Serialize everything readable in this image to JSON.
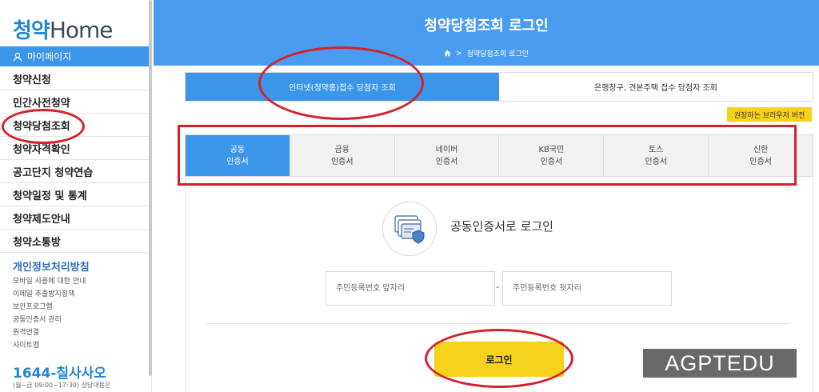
{
  "sidebar": {
    "logo_ko": "청약",
    "logo_en": "Home",
    "mypage_label": "마이페이지",
    "menu": [
      "청약신청",
      "민간사전청약",
      "청약당첨조회",
      "청약자격확인",
      "공고단지 청약연습",
      "청약일정 및 통계",
      "청약제도안내",
      "청약소통방"
    ],
    "privacy_title": "개인정보처리방침",
    "links": [
      "모바일 사용에 대한 안내",
      "이메일 추출방지정책",
      "보안프로그램",
      "공동인증서 관리",
      "원격연결",
      "사이트맵"
    ],
    "phone": "1644-칠사사오",
    "hours": "(월~금 09:00~17:30) 상담내용은"
  },
  "header": {
    "title": "청약당첨조회 로그인",
    "breadcrumb": "청약당첨조회 로그인"
  },
  "top_tabs": [
    {
      "label": "인터넷(청약홈)접수 당첨자 조회",
      "active": true
    },
    {
      "label": "은행창구, 견본주택 접수 당첨자 조회",
      "active": false
    }
  ],
  "browser_badge": "권장하는 브라우저 버전",
  "cert_tabs": [
    {
      "line1": "공동",
      "line2": "인증서",
      "active": true
    },
    {
      "line1": "금융",
      "line2": "인증서",
      "active": false
    },
    {
      "line1": "네이버",
      "line2": "인증서",
      "active": false
    },
    {
      "line1": "KB국민",
      "line2": "인증서",
      "active": false
    },
    {
      "line1": "토스",
      "line2": "인증서",
      "active": false
    },
    {
      "line1": "신한",
      "line2": "인증서",
      "active": false
    }
  ],
  "login": {
    "title": "공동인증서로 로그인",
    "id_front_placeholder": "주민등록번호 앞자리",
    "id_back_placeholder": "주민등록번호 뒷자리",
    "separator": "-",
    "button": "로그인"
  },
  "colors": {
    "primary_blue": "#3b95e8",
    "header_blue": "#4a9cf0",
    "accent_yellow": "#f7d21b",
    "annotation_red": "#d6202a"
  },
  "watermark": "AGPTEDU"
}
